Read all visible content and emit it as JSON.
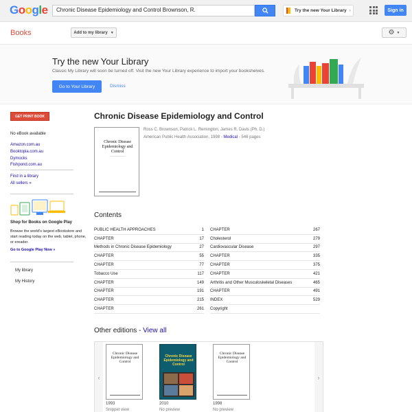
{
  "header": {
    "logo": "Google",
    "search_value": "Chronic Disease Epidemiology and Control Brownson, R.",
    "try_library": "Try the new Your Library",
    "signin": "Sign in"
  },
  "secbar": {
    "books": "Books",
    "add_to_library": "Add to my library"
  },
  "promo": {
    "title": "Try the new Your Library",
    "text": "Classic My Library will soon be turned off. Visit the new Your Library experience to import your bookshelves.",
    "goto": "Go to Your Library",
    "dismiss": "Dismiss"
  },
  "left": {
    "get_print": "GET PRINT BOOK",
    "no_ebook": "No eBook available",
    "stores": [
      "Amazon.com.au",
      "Booktopia.com.au",
      "Dymocks",
      "Fishpond.com.au"
    ],
    "find_library": "Find in a library",
    "all_sellers": "All sellers »",
    "shop_title": "Shop for Books on Google Play",
    "shop_text": "Browse the world's largest eBookstore and start reading today on the web, tablet, phone, or ereader.",
    "shop_link": "Go to Google Play Now »",
    "my_library": "My library",
    "my_history": "My History"
  },
  "book": {
    "title": "Chronic Disease Epidemiology and Control",
    "authors": "Ross C. Brownson, Patrick L. Remington, James R. Davis (Ph. D.)",
    "publisher": "American Public Health Association, 1998 - ",
    "category": "Medical",
    "pages": " - 546 pages",
    "cover_title": "Chronic Disease Epidemiology and Control"
  },
  "contents": {
    "heading": "Contents",
    "left": [
      {
        "title": "PUBLIC HEALTH APPROACHES",
        "page": "1"
      },
      {
        "title": "CHAPTER",
        "page": "17"
      },
      {
        "title": "Methods in Chronic Disease Epidemiology",
        "page": "27"
      },
      {
        "title": "CHAPTER",
        "page": "55"
      },
      {
        "title": "CHAPTER",
        "page": "77"
      },
      {
        "title": "Tobacco Use",
        "page": "117"
      },
      {
        "title": "CHAPTER",
        "page": "149"
      },
      {
        "title": "CHAPTER",
        "page": "191"
      },
      {
        "title": "CHAPTER",
        "page": "215"
      },
      {
        "title": "CHAPTER",
        "page": "261"
      }
    ],
    "right": [
      {
        "title": "CHAPTER",
        "page": "267"
      },
      {
        "title": "Cholesterol",
        "page": "279"
      },
      {
        "title": "Cardiovascular Disease",
        "page": "297"
      },
      {
        "title": "CHAPTER",
        "page": "335"
      },
      {
        "title": "CHAPTER",
        "page": "375"
      },
      {
        "title": "CHAPTER",
        "page": "421"
      },
      {
        "title": "Arthritis and Other Musculoskeletal Diseases",
        "page": "465"
      },
      {
        "title": "CHAPTER",
        "page": "491"
      },
      {
        "title": "INDEX",
        "page": "529"
      },
      {
        "title": "Copyright",
        "page": ""
      }
    ]
  },
  "editions": {
    "heading": "Other editions - ",
    "view_all": "View all",
    "items": [
      {
        "cover_title": "Chronic Disease Epidemiology and Control",
        "year": "1993",
        "status": "Snippet view"
      },
      {
        "cover_title": "Chronic Disease Epidemiology and Control",
        "year": "2010",
        "status": "No preview"
      },
      {
        "cover_title": "Chronic Disease Epidemiology and Control",
        "year": "1998",
        "status": "No preview"
      }
    ]
  },
  "colors": {
    "accent_blue": "#4285f4",
    "books_red": "#dd4b39",
    "link_blue": "#1a0dab"
  }
}
